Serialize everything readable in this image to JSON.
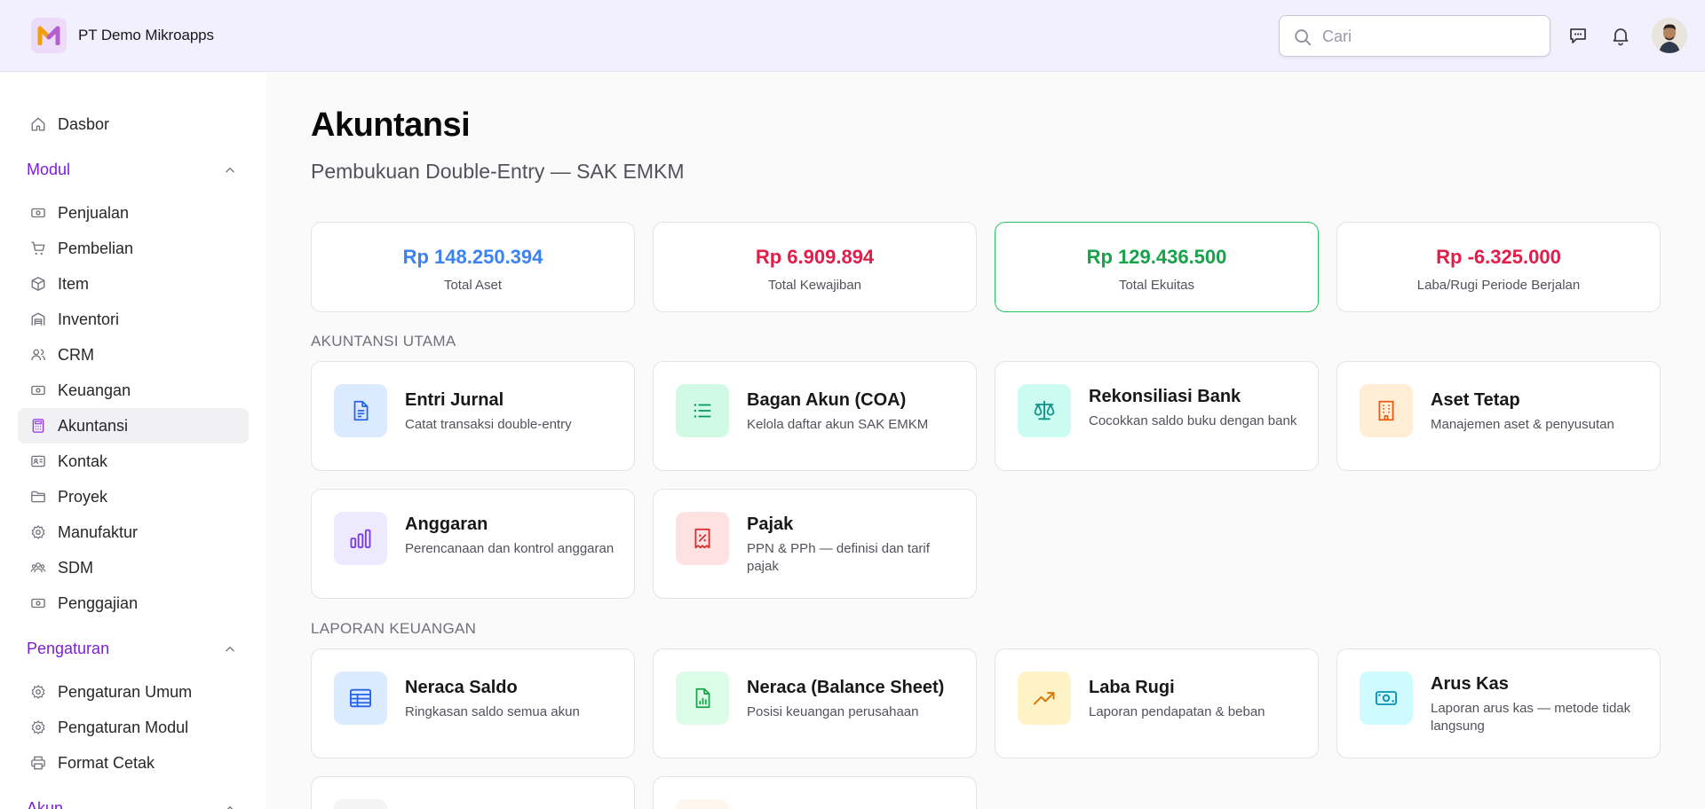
{
  "header": {
    "company": "PT Demo Mikroapps",
    "search_placeholder": "Cari"
  },
  "sidebar": {
    "top_items": [
      {
        "label": "Dasbor",
        "icon": "home-icon"
      }
    ],
    "sections": {
      "modul": "Modul",
      "pengaturan": "Pengaturan",
      "akun": "Akun"
    },
    "modul_items": [
      {
        "label": "Penjualan",
        "icon": "banknote-icon"
      },
      {
        "label": "Pembelian",
        "icon": "cart-icon"
      },
      {
        "label": "Item",
        "icon": "box-icon"
      },
      {
        "label": "Inventori",
        "icon": "warehouse-icon"
      },
      {
        "label": "CRM",
        "icon": "users-icon"
      },
      {
        "label": "Keuangan",
        "icon": "banknote-icon"
      },
      {
        "label": "Akuntansi",
        "icon": "calculator-icon",
        "active": true
      },
      {
        "label": "Kontak",
        "icon": "contact-card-icon"
      },
      {
        "label": "Proyek",
        "icon": "folder-icon"
      },
      {
        "label": "Manufaktur",
        "icon": "gear-icon"
      },
      {
        "label": "SDM",
        "icon": "team-icon"
      },
      {
        "label": "Penggajian",
        "icon": "banknote-icon"
      }
    ],
    "pengaturan_items": [
      {
        "label": "Pengaturan Umum",
        "icon": "gear-icon"
      },
      {
        "label": "Pengaturan Modul",
        "icon": "gear-icon"
      },
      {
        "label": "Format Cetak",
        "icon": "printer-icon"
      }
    ]
  },
  "main": {
    "title": "Akuntansi",
    "subtitle": "Pembukuan Double-Entry — SAK EMKM",
    "stats": [
      {
        "value": "Rp 148.250.394",
        "label": "Total Aset",
        "color": "#3b82f6"
      },
      {
        "value": "Rp 6.909.894",
        "label": "Total Kewajiban",
        "color": "#e11d48"
      },
      {
        "value": "Rp 129.436.500",
        "label": "Total Ekuitas",
        "color": "#16a34a"
      },
      {
        "value": "Rp -6.325.000",
        "label": "Laba/Rugi Periode Berjalan",
        "color": "#e11d48"
      }
    ],
    "groups": {
      "utama": "AKUNTANSI UTAMA",
      "laporan": "LAPORAN KEUANGAN"
    },
    "utama_cards": [
      {
        "title": "Entri Jurnal",
        "desc": "Catat transaksi double-entry",
        "icon": "document-icon",
        "tile": "#dbeafe",
        "stroke": "#2563eb"
      },
      {
        "title": "Bagan Akun (COA)",
        "desc": "Kelola daftar akun SAK EMKM",
        "icon": "list-icon",
        "tile": "#d1fae5",
        "stroke": "#059669"
      },
      {
        "title": "Rekonsiliasi Bank",
        "desc": "Cocokkan saldo buku dengan bank",
        "icon": "scale-icon",
        "tile": "#ccfbf1",
        "stroke": "#0d9488"
      },
      {
        "title": "Aset Tetap",
        "desc": "Manajemen aset & penyusutan",
        "icon": "building-icon",
        "tile": "#ffedd5",
        "stroke": "#ea580c"
      },
      {
        "title": "Anggaran",
        "desc": "Perencanaan dan kontrol anggaran",
        "icon": "bar-chart-icon",
        "tile": "#ede9fe",
        "stroke": "#7c3aed"
      },
      {
        "title": "Pajak",
        "desc": "PPN & PPh — definisi dan tarif pajak",
        "icon": "tax-receipt-icon",
        "tile": "#fee2e2",
        "stroke": "#dc2626"
      }
    ],
    "laporan_cards": [
      {
        "title": "Neraca Saldo",
        "desc": "Ringkasan saldo semua akun",
        "icon": "table-icon",
        "tile": "#dbeafe",
        "stroke": "#2563eb"
      },
      {
        "title": "Neraca (Balance Sheet)",
        "desc": "Posisi keuangan perusahaan",
        "icon": "file-chart-icon",
        "tile": "#dcfce7",
        "stroke": "#16a34a"
      },
      {
        "title": "Laba Rugi",
        "desc": "Laporan pendapatan & beban",
        "icon": "trending-up-icon",
        "tile": "#fef3c7",
        "stroke": "#d97706"
      },
      {
        "title": "Arus Kas",
        "desc": "Laporan arus kas — metode tidak langsung",
        "icon": "cash-icon",
        "tile": "#cffafe",
        "stroke": "#0891b2"
      }
    ]
  }
}
